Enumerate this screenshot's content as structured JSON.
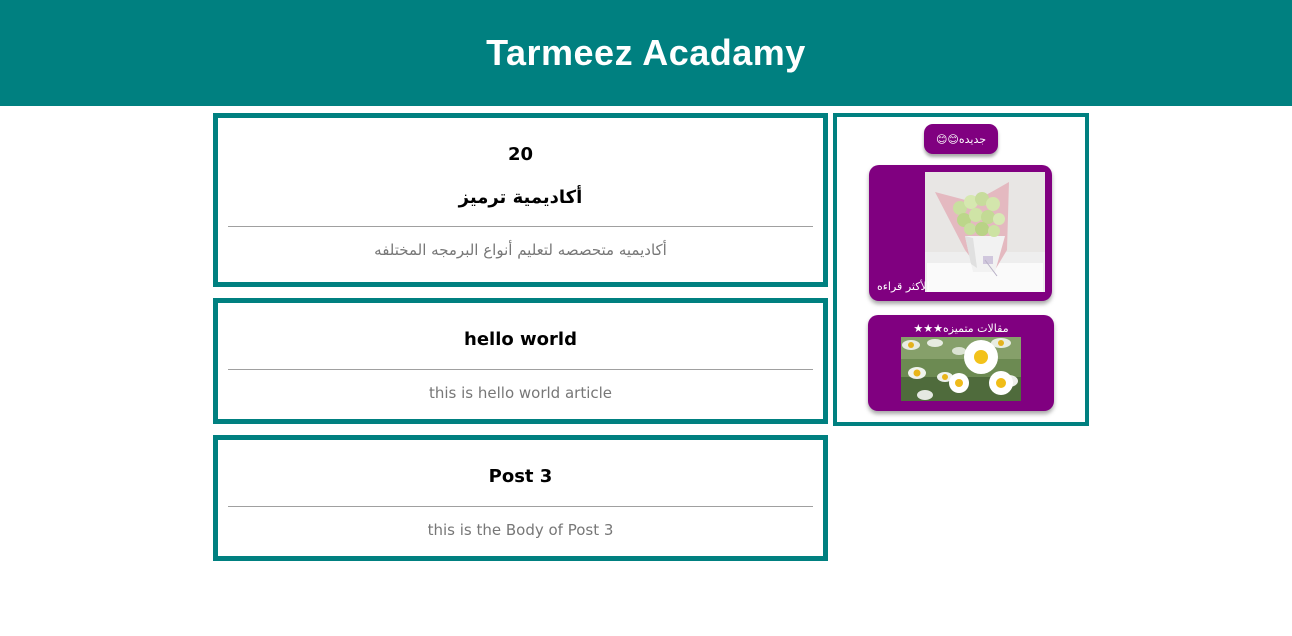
{
  "header": {
    "title": "Tarmeez Acadamy"
  },
  "posts": [
    {
      "title_number": "20",
      "title": "أكاديمية ترميز",
      "body": "أكاديميه متحصصه لتعليم أنواع البرمجه المختلفه"
    },
    {
      "title": "hello world",
      "body": "this is hello world article"
    },
    {
      "title": "Post 3",
      "body": "this is the Body of Post 3"
    }
  ],
  "sidebar": {
    "badge_label": "جديده😊😊",
    "most_read_label": "الأكثر قراءه",
    "featured_label": "مقالات متميزه★★★",
    "most_read_image_icon": "flower-bouquet-photo",
    "featured_image_icon": "daisy-photo"
  },
  "colors": {
    "primary": "#008080",
    "accent": "#800080",
    "text_muted": "#777777"
  }
}
